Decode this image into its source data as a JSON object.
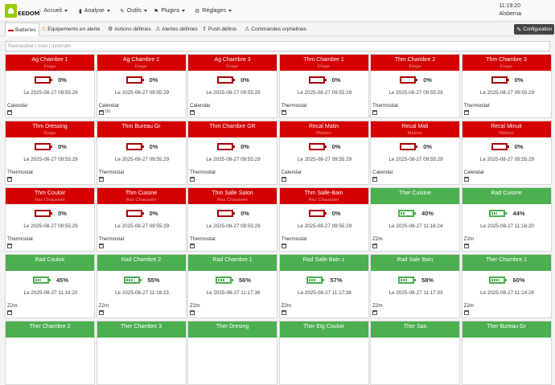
{
  "logo": {
    "text_a": "EE",
    "text_b": "DOM"
  },
  "nav": {
    "items": [
      {
        "icon": "⌂",
        "label": "Accueil"
      },
      {
        "icon": "▮",
        "label": "Analyse"
      },
      {
        "icon": "✎",
        "label": "Outils"
      },
      {
        "icon": "⚑",
        "label": "Plugins"
      },
      {
        "icon": "⚙",
        "label": "Réglages"
      }
    ],
    "time": "11:19:20",
    "user": "Alsberna"
  },
  "tabs": [
    {
      "icon": "▬",
      "label": "Batteries"
    },
    {
      "icon": "⚠",
      "label": "Equipements en alerte"
    },
    {
      "icon": "⚙",
      "label": "Actions définies"
    },
    {
      "icon": "⚠",
      "label": "Alertes définies"
    },
    {
      "icon": "⇪",
      "label": "Push définis"
    },
    {
      "icon": "⚠",
      "label": "Commandes orphelines"
    }
  ],
  "config_button": "Configuration",
  "search": {
    "placeholder": "Rechercher | nom | mot/nom"
  },
  "colors": {
    "alert_red": "#d40000",
    "ok_green": "#4caf50",
    "brand": "#94ca02"
  },
  "cards": [
    {
      "name": "Ag Chambre 1",
      "location": "Etage",
      "status": "red",
      "percent": "0%",
      "level": 0,
      "timestamp": "Le 2025-08-27 09:55:29",
      "type": "Calendar",
      "extra": ""
    },
    {
      "name": "Ag Chambre 2",
      "location": "Etage",
      "status": "red",
      "percent": "0%",
      "level": 0,
      "timestamp": "Le 2025-08-27 09:55:29",
      "type": "Calendar",
      "extra": "(9)"
    },
    {
      "name": "Ag Chambre 3",
      "location": "Etage",
      "status": "red",
      "percent": "0%",
      "level": 0,
      "timestamp": "Le 2025-08-27 09:55:29",
      "type": "Calendar",
      "extra": ""
    },
    {
      "name": "Thm Chambre 1",
      "location": "Etage",
      "status": "red",
      "percent": "0%",
      "level": 0,
      "timestamp": "Le 2025-08-27 09:55:29",
      "type": "Thermostat",
      "extra": ""
    },
    {
      "name": "Thm Chambre 2",
      "location": "Etage",
      "status": "red",
      "percent": "0%",
      "level": 0,
      "timestamp": "Le 2025-08-27 09:55:29",
      "type": "Thermostat",
      "extra": ""
    },
    {
      "name": "Thm Chambre 3",
      "location": "Etage",
      "status": "red",
      "percent": "0%",
      "level": 0,
      "timestamp": "Le 2025-08-27 09:55:29",
      "type": "Thermostat",
      "extra": ""
    },
    {
      "name": "Thm Dressing",
      "location": "Etage",
      "status": "red",
      "percent": "0%",
      "level": 0,
      "timestamp": "Le 2025-08-27 09:55:29",
      "type": "Thermostat",
      "extra": ""
    },
    {
      "name": "Thm Bureau Gr",
      "location": "",
      "status": "red",
      "percent": "0%",
      "level": 0,
      "timestamp": "Le 2025-08-27 09:55:29",
      "type": "Thermostat",
      "extra": ""
    },
    {
      "name": "Thm Chambre GR",
      "location": "",
      "status": "red",
      "percent": "0%",
      "level": 0,
      "timestamp": "Le 2025-08-27 09:55:29",
      "type": "Thermostat",
      "extra": ""
    },
    {
      "name": "Recal Matin",
      "location": "Maison",
      "status": "red",
      "percent": "0%",
      "level": 0,
      "timestamp": "Le 2025-08-27 09:55:29",
      "type": "Calendar",
      "extra": ""
    },
    {
      "name": "Recal Midi",
      "location": "Maison",
      "status": "red",
      "percent": "0%",
      "level": 0,
      "timestamp": "Le 2025-08-27 09:55:29",
      "type": "Calendar",
      "extra": ""
    },
    {
      "name": "Recal Minuit",
      "location": "Maison",
      "status": "red",
      "percent": "0%",
      "level": 0,
      "timestamp": "Le 2025-08-27 09:55:29",
      "type": "Calendar",
      "extra": ""
    },
    {
      "name": "Thm Couloir",
      "location": "Rez Chaussée",
      "status": "red",
      "percent": "0%",
      "level": 0,
      "timestamp": "Le 2025-08-27 09:55:29",
      "type": "Thermostat",
      "extra": ""
    },
    {
      "name": "Thm Cuisine",
      "location": "Rez Chaussée",
      "status": "red",
      "percent": "0%",
      "level": 0,
      "timestamp": "Le 2025-08-27 09:55:29",
      "type": "Thermostat",
      "extra": ""
    },
    {
      "name": "Thm Salle Salon",
      "location": "Rez Chaussée",
      "status": "red",
      "percent": "0%",
      "level": 0,
      "timestamp": "Le 2025-08-27 09:55:29",
      "type": "Thermostat",
      "extra": ""
    },
    {
      "name": "Thm Salle-Bain",
      "location": "Rez Chaussée",
      "status": "red",
      "percent": "0%",
      "level": 0,
      "timestamp": "Le 2025-08-27 09:55:29",
      "type": "Thermostat",
      "extra": ""
    },
    {
      "name": "Ther Cuisine",
      "location": "",
      "status": "green",
      "percent": "40%",
      "level": 0.4,
      "timestamp": "Le 2025-08-27 11:16:24",
      "type": "Z2m",
      "extra": ""
    },
    {
      "name": "Rad Cuisine",
      "location": "",
      "status": "green",
      "percent": "44%",
      "level": 0.44,
      "timestamp": "Le 2025-08-27 11:16:20",
      "type": "Z2m",
      "extra": ""
    },
    {
      "name": "Rad Couloir",
      "location": "",
      "status": "green",
      "percent": "45%",
      "level": 0.45,
      "timestamp": "Le 2025-08-27 11:16:20",
      "type": "Z2m",
      "extra": ""
    },
    {
      "name": "Rad Chambre 2",
      "location": "",
      "status": "green",
      "percent": "55%",
      "level": 0.55,
      "timestamp": "Le 2025-08-27 11:16:23",
      "type": "Z2m",
      "extra": ""
    },
    {
      "name": "Rad Chambre 1",
      "location": "",
      "status": "green",
      "percent": "56%",
      "level": 0.56,
      "timestamp": "Le 2025-08-27 11:17:36",
      "type": "Z2m",
      "extra": ""
    },
    {
      "name": "Rad Salle Bain z",
      "location": "",
      "status": "green",
      "percent": "57%",
      "level": 0.57,
      "timestamp": "Le 2025-08-27 11:17:38",
      "type": "Z2m",
      "extra": ""
    },
    {
      "name": "Rad Sale Bain",
      "location": "",
      "status": "green",
      "percent": "58%",
      "level": 0.58,
      "timestamp": "Le 2025-08-27 11:17:33",
      "type": "Z2m",
      "extra": ""
    },
    {
      "name": "Ther Chambre 1",
      "location": "",
      "status": "green",
      "percent": "60%",
      "level": 0.6,
      "timestamp": "Le 2025-08-27 11:14:28",
      "type": "Z2m",
      "extra": ""
    },
    {
      "name": "Ther Chambre 2",
      "location": "",
      "status": "green",
      "percent": "",
      "level": 0,
      "timestamp": "",
      "type": "",
      "extra": ""
    },
    {
      "name": "Ther Chambre 3",
      "location": "",
      "status": "green",
      "percent": "",
      "level": 0,
      "timestamp": "",
      "type": "",
      "extra": ""
    },
    {
      "name": "Ther Dresing",
      "location": "",
      "status": "green",
      "percent": "",
      "level": 0,
      "timestamp": "",
      "type": "",
      "extra": ""
    },
    {
      "name": "Ther Etg Couloir",
      "location": "",
      "status": "green",
      "percent": "",
      "level": 0,
      "timestamp": "",
      "type": "",
      "extra": ""
    },
    {
      "name": "Ther Sas",
      "location": "",
      "status": "green",
      "percent": "",
      "level": 0,
      "timestamp": "",
      "type": "",
      "extra": ""
    },
    {
      "name": "Ther Bureau Gr",
      "location": "",
      "status": "green",
      "percent": "",
      "level": 0,
      "timestamp": "",
      "type": "",
      "extra": ""
    }
  ]
}
